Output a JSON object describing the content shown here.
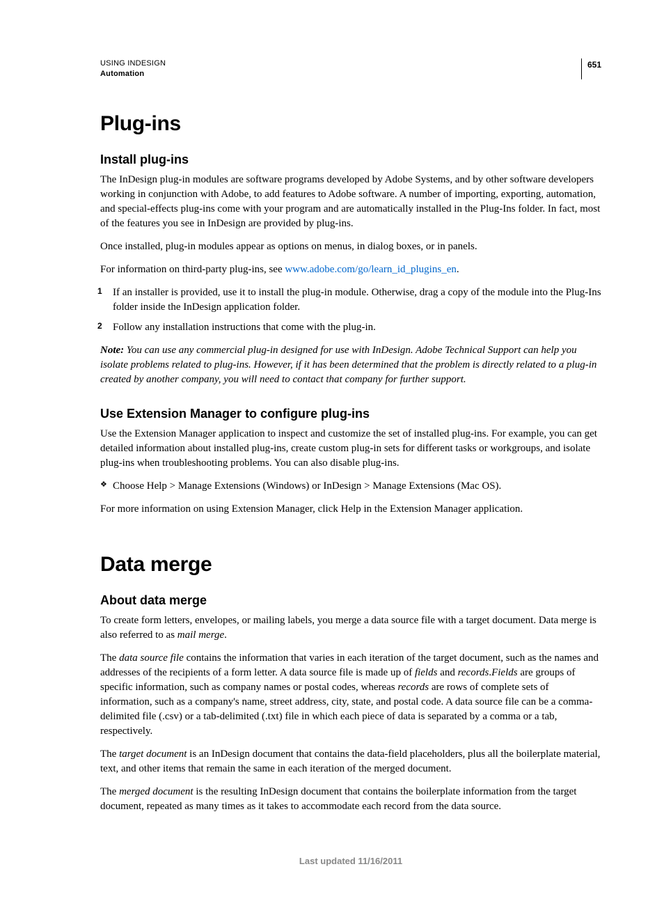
{
  "header": {
    "product": "USING INDESIGN",
    "section": "Automation",
    "page_number": "651"
  },
  "section1": {
    "title": "Plug-ins",
    "sub1": {
      "heading": "Install plug-ins",
      "p1": "The InDesign plug-in modules are software programs developed by Adobe Systems, and by other software developers working in conjunction with Adobe, to add features to Adobe software. A number of importing, exporting, automation, and special-effects plug-ins come with your program and are automatically installed in the Plug-Ins folder. In fact, most of the features you see in InDesign are provided by plug-ins.",
      "p2": "Once installed, plug-in modules appear as options on menus, in dialog boxes, or in panels.",
      "p3_pre": "For information on third-party plug-ins, see ",
      "p3_link": "www.adobe.com/go/learn_id_plugins_en",
      "p3_post": ".",
      "step1_num": "1",
      "step1": "If an installer is provided, use it to install the plug-in module. Otherwise, drag a copy of the module into the Plug-Ins folder inside the InDesign application folder.",
      "step2_num": "2",
      "step2": "Follow any installation instructions that come with the plug-in.",
      "note_label": "Note: ",
      "note_body": "You can use any commercial plug-in designed for use with InDesign. Adobe Technical Support can help you isolate problems related to plug-ins. However, if it has been determined that the problem is directly related to a plug-in created by another company, you will need to contact that company for further support."
    },
    "sub2": {
      "heading": "Use Extension Manager to configure plug-ins",
      "p1": "Use the Extension Manager application to inspect and customize the set of installed plug-ins. For example, you can get detailed information about installed plug-ins, create custom plug-in sets for different tasks or workgroups, and isolate plug-ins when troubleshooting problems. You can also disable plug-ins.",
      "bullet1": "Choose Help > Manage Extensions (Windows) or InDesign > Manage Extensions (Mac OS).",
      "p2": "For more information on using Extension Manager, click Help in the Extension Manager application."
    }
  },
  "section2": {
    "title": "Data merge",
    "sub1": {
      "heading": "About data merge",
      "p1_a": "To create form letters, envelopes, or mailing labels, you merge a data source file with a target document. Data merge is also referred to as ",
      "p1_em": "mail merge",
      "p1_b": ".",
      "p2_a": "The ",
      "p2_em1": "data source file",
      "p2_b": " contains the information that varies in each iteration of the target document, such as the names and addresses of the recipients of a form letter. A data source file is made up of ",
      "p2_em2": "fields",
      "p2_c": " and ",
      "p2_em3": "records",
      "p2_d": ".",
      "p2_em4": "Fields",
      "p2_e": " are groups of specific information, such as company names or postal codes, whereas ",
      "p2_em5": "records",
      "p2_f": " are rows of complete sets of information, such as a company's name, street address, city, state, and postal code. A data source file can be a comma-delimited file (.csv) or a tab-delimited (.txt) file in which each piece of data is separated by a comma or a tab, respectively.",
      "p3_a": "The ",
      "p3_em": "target document",
      "p3_b": " is an InDesign document that contains the data-field placeholders, plus all the boilerplate material, text, and other items that remain the same in each iteration of the merged document.",
      "p4_a": "The ",
      "p4_em": "merged document",
      "p4_b": " is the resulting InDesign document that contains the boilerplate information from the target document, repeated as many times as it takes to accommodate each record from the data source."
    }
  },
  "footer": "Last updated 11/16/2011"
}
